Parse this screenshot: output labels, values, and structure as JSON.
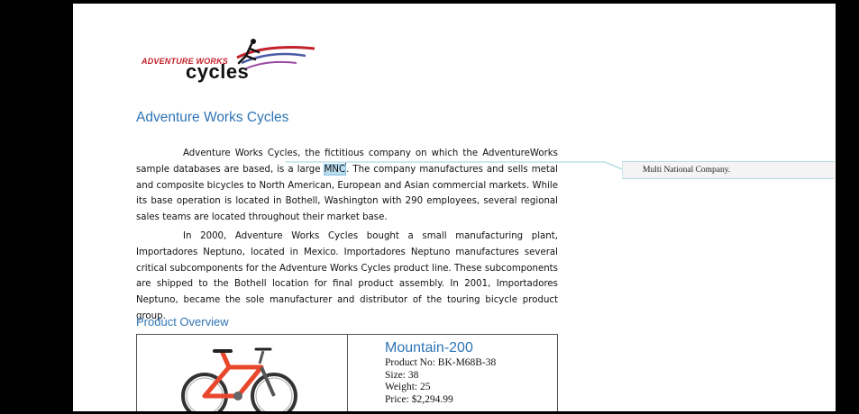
{
  "document": {
    "logo": {
      "top_text": "ADVENTURE WORKS",
      "bottom_text": "cycles"
    },
    "heading": "Adventure Works Cycles",
    "paragraphs": [
      {
        "before": "Adventure Works Cycles, the fictitious company on which the AdventureWorks sample databases are based, is a large ",
        "highlight": "MNC",
        "after": ". The company manufactures and sells metal and composite bicycles to North American, European and Asian commercial markets. While its base operation is located in Bothell, Washington with 290 employees, several regional sales teams are located throughout their market base."
      },
      {
        "text": "In 2000, Adventure Works Cycles bought a small manufacturing plant, Importadores Neptuno, located in Mexico. Importadores Neptuno manufactures several critical subcomponents for the Adventure Works Cycles product line. These subcomponents are shipped to the Bothell location for final product assembly. In 2001, Importadores Neptuno, became the sole manufacturer and distributor of the touring bicycle product group."
      }
    ],
    "subheading": "Product Overview",
    "product": {
      "name": "Mountain-200",
      "product_no": "Product No: BK-M68B-38",
      "size": "Size: 38",
      "weight": "Weight: 25",
      "price": "Price: $2,294.99"
    }
  },
  "comment": {
    "text": "Multi National Company."
  },
  "colors": {
    "heading": "#2e74b5",
    "highlight": "#b9ddf0",
    "logo_red": "#c3202a",
    "bike_frame": "#e8472c",
    "comment_bg": "#f4f4f4"
  }
}
